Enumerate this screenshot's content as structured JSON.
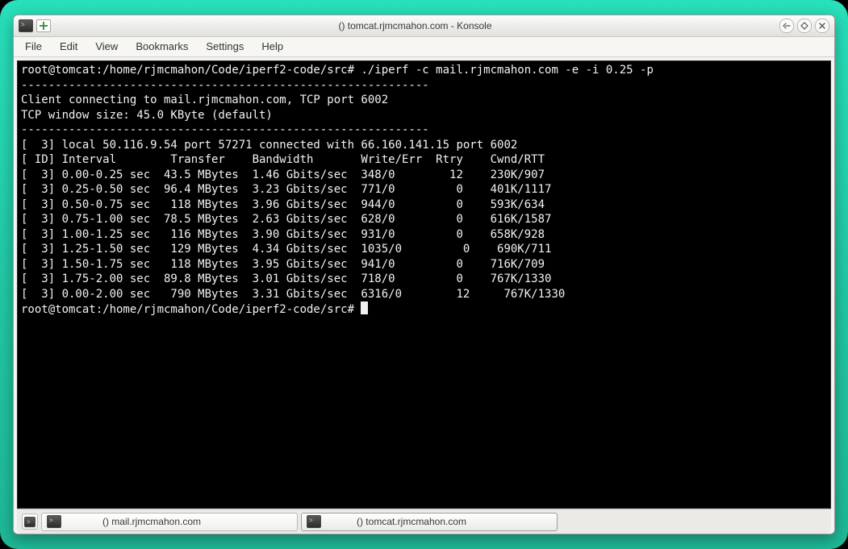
{
  "window": {
    "app": "Konsole",
    "title": "() tomcat.rjmcmahon.com - Konsole"
  },
  "menu": {
    "items": [
      "File",
      "Edit",
      "View",
      "Bookmarks",
      "Settings",
      "Help"
    ]
  },
  "terminal": {
    "prompt1": "root@tomcat:/home/rjmcmahon/Code/iperf2-code/src#",
    "cmd": " ./iperf -c mail.rjmcmahon.com -e -i 0.25 -p",
    "dash1": "------------------------------------------------------------",
    "line_connect": "Client connecting to mail.rjmcmahon.com, TCP port 6002",
    "line_winsize": "TCP window size: 45.0 KByte (default)",
    "dash2": "------------------------------------------------------------",
    "line_local": "[  3] local 50.116.9.54 port 57271 connected with 66.160.141.15 port 6002",
    "header": "[ ID] Interval        Transfer    Bandwidth       Write/Err  Rtry    Cwnd/RTT",
    "rows": [
      "[  3] 0.00-0.25 sec  43.5 MBytes  1.46 Gbits/sec  348/0        12    230K/907",
      "[  3] 0.25-0.50 sec  96.4 MBytes  3.23 Gbits/sec  771/0         0    401K/1117",
      "[  3] 0.50-0.75 sec   118 MBytes  3.96 Gbits/sec  944/0         0    593K/634",
      "[  3] 0.75-1.00 sec  78.5 MBytes  2.63 Gbits/sec  628/0         0    616K/1587",
      "[  3] 1.00-1.25 sec   116 MBytes  3.90 Gbits/sec  931/0         0    658K/928",
      "[  3] 1.25-1.50 sec   129 MBytes  4.34 Gbits/sec  1035/0         0    690K/711",
      "[  3] 1.50-1.75 sec   118 MBytes  3.95 Gbits/sec  941/0         0    716K/709",
      "[  3] 1.75-2.00 sec  89.8 MBytes  3.01 Gbits/sec  718/0         0    767K/1330",
      "[  3] 0.00-2.00 sec   790 MBytes  3.31 Gbits/sec  6316/0        12     767K/1330"
    ],
    "prompt2": "root@tomcat:/home/rjmcmahon/Code/iperf2-code/src# "
  },
  "tabs": {
    "items": [
      {
        "label": "() mail.rjmcmahon.com",
        "active": false
      },
      {
        "label": "() tomcat.rjmcmahon.com",
        "active": true
      }
    ]
  }
}
